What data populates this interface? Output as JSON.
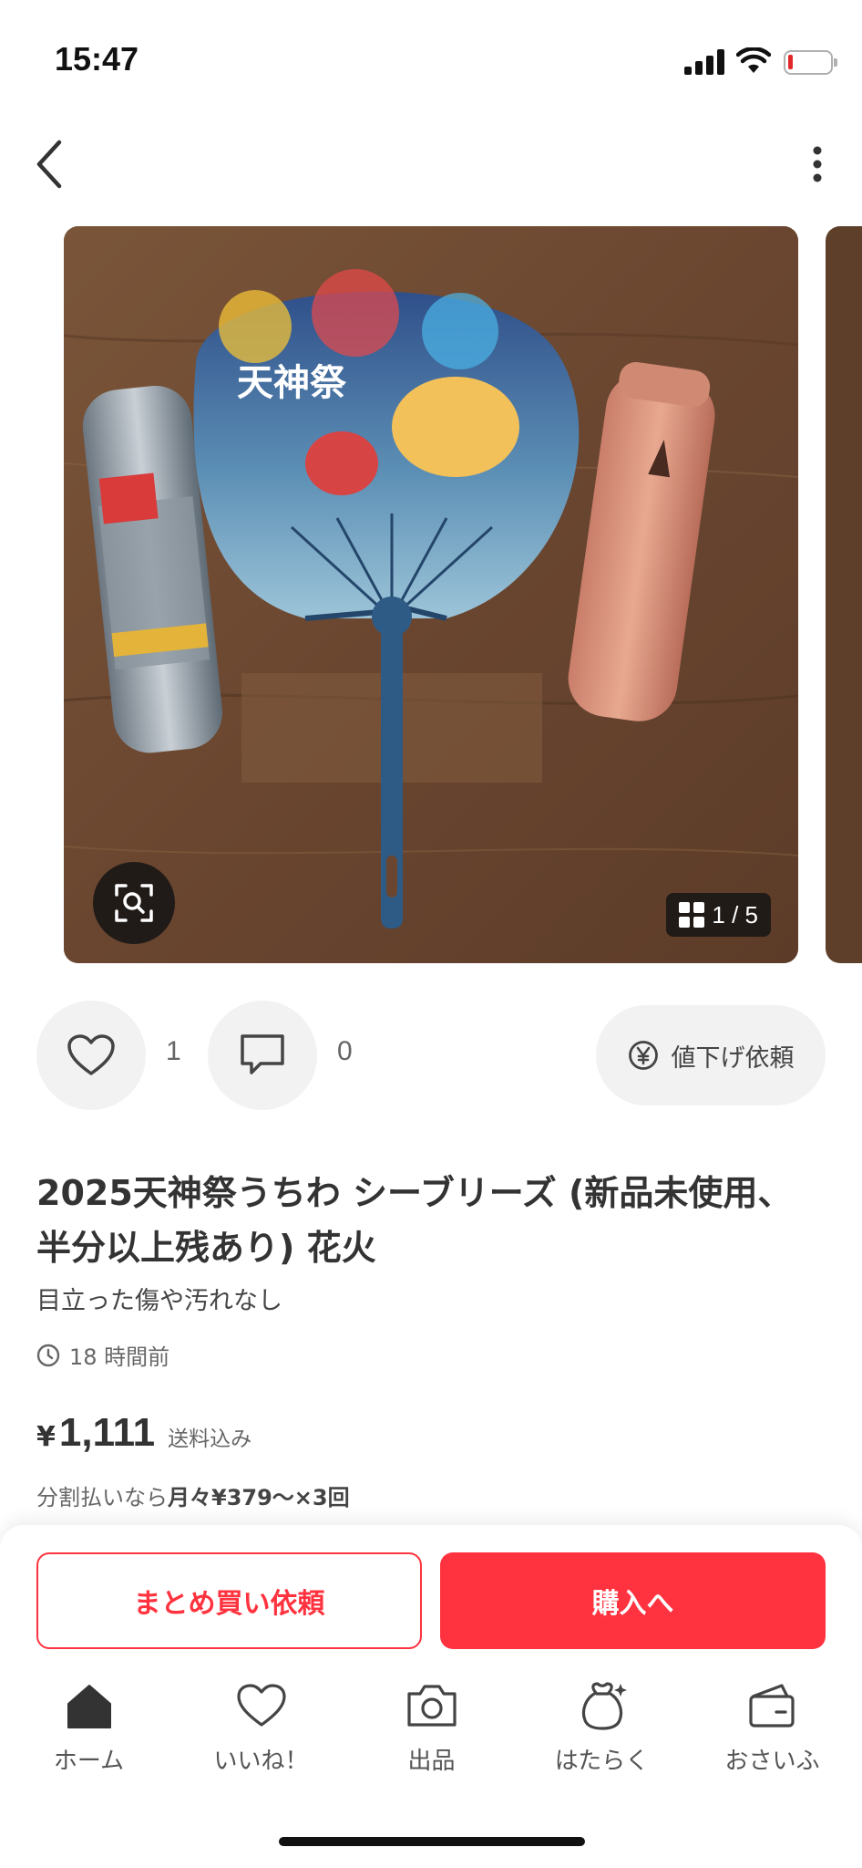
{
  "status": {
    "time": "15:47"
  },
  "gallery": {
    "counter": "1 / 5"
  },
  "actions": {
    "like_count": "1",
    "comment_count": "0",
    "price_cut_label": "値下げ依頼"
  },
  "item": {
    "title": "2025天神祭うちわ シーブリーズ (新品未使用、半分以上残あり) 花火",
    "condition": "目立った傷や汚れなし",
    "posted": "18 時間前",
    "currency": "¥",
    "price": "1,111",
    "shipping": "送料込み",
    "installment_prefix": "分割払いなら",
    "installment_value": "月々¥379～×3回"
  },
  "buttons": {
    "bulk_request": "まとめ買い依頼",
    "buy": "購入へ"
  },
  "tabs": [
    {
      "label": "ホーム",
      "icon": "home-icon"
    },
    {
      "label": "いいね！",
      "icon": "heart-icon"
    },
    {
      "label": "出品",
      "icon": "camera-icon"
    },
    {
      "label": "はたらく",
      "icon": "money-bag-icon"
    },
    {
      "label": "おさいふ",
      "icon": "wallet-icon"
    }
  ],
  "colors": {
    "accent": "#ff333f",
    "text": "#333333",
    "muted": "#666666",
    "chip_bg": "#f2f2f2"
  }
}
